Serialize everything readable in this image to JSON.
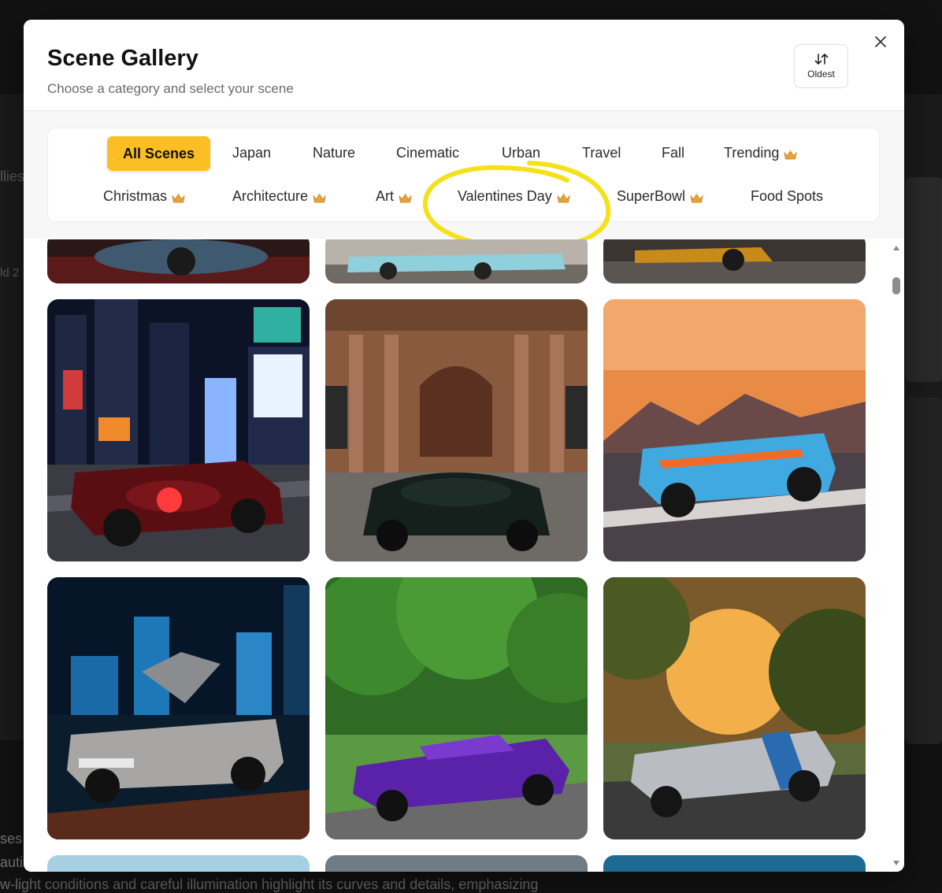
{
  "background": {
    "fragments": [
      "llies",
      "ld 2",
      "ses",
      "auti",
      "w-light conditions and careful illumination highlight its curves and details, emphasizing"
    ]
  },
  "modal": {
    "title": "Scene Gallery",
    "subtitle": "Choose a category and select your scene",
    "sort": {
      "label": "Oldest",
      "icon": "sort-arrows-icon"
    },
    "close_icon": "close-icon"
  },
  "categories": [
    {
      "label": "All Scenes",
      "active": true,
      "premium": false
    },
    {
      "label": "Japan",
      "active": false,
      "premium": false
    },
    {
      "label": "Nature",
      "active": false,
      "premium": false
    },
    {
      "label": "Cinematic",
      "active": false,
      "premium": false
    },
    {
      "label": "Urban",
      "active": false,
      "premium": false
    },
    {
      "label": "Travel",
      "active": false,
      "premium": false
    },
    {
      "label": "Fall",
      "active": false,
      "premium": false
    },
    {
      "label": "Trending",
      "active": false,
      "premium": true
    },
    {
      "label": "Christmas",
      "active": false,
      "premium": true
    },
    {
      "label": "Architecture",
      "active": false,
      "premium": true
    },
    {
      "label": "Art",
      "active": false,
      "premium": true
    },
    {
      "label": "Valentines Day",
      "active": false,
      "premium": true
    },
    {
      "label": "SuperBowl",
      "active": false,
      "premium": true
    },
    {
      "label": "Food Spots",
      "active": false,
      "premium": false
    }
  ],
  "annotation": {
    "color": "#f5e11b",
    "target": "Valentines Day"
  },
  "colors": {
    "accent": "#fbbf24",
    "crown": "#e8a33a"
  },
  "scenes": [
    {
      "name": "red-sports-car-partial"
    },
    {
      "name": "turquoise-convertible-partial"
    },
    {
      "name": "orange-supercar-partial"
    },
    {
      "name": "red-hypercar-times-square-night"
    },
    {
      "name": "black-hypercar-stone-building"
    },
    {
      "name": "blue-orange-racecar-sunset-track"
    },
    {
      "name": "delorean-gullwing-city-night"
    },
    {
      "name": "purple-supercar-forest-road"
    },
    {
      "name": "silver-striped-coupe-sunset-trees"
    },
    {
      "name": "sky-scene-partial"
    },
    {
      "name": "cloudy-scene-partial"
    },
    {
      "name": "ocean-scene-partial"
    }
  ]
}
